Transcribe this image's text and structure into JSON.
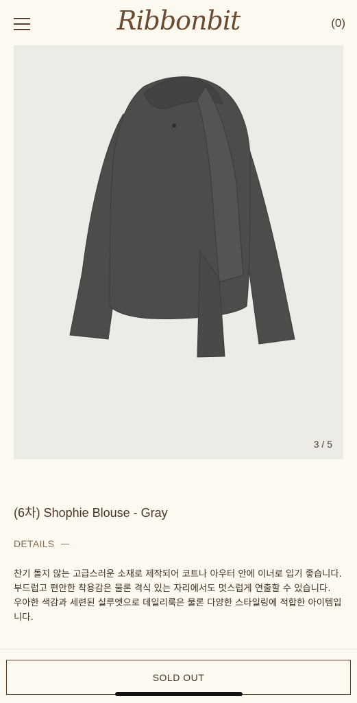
{
  "header": {
    "brand": "Ribbonbit",
    "cart_count": "(0)"
  },
  "gallery": {
    "counter": "3 / 5",
    "background": "#ecebe6",
    "garment_color": "#4d4c4a"
  },
  "product": {
    "title": "(6차) Shophie Blouse - Gray",
    "details_label": "DETAILS",
    "description": [
      "찬기 돌지 않는 고급스러운 소재로 제작되어 코트나 아우터 안에 이너로 입기 좋습니다.",
      "부드럽고 편안한 착용감은 물론 격식 있는 자리에서도 멋스럽게 연출할 수 있습니다.",
      "우아한 색감과 세련된 실루엣으로 데일리룩은 물론 다양한 스타일링에 적합한 아이템입니다."
    ]
  },
  "actions": {
    "sold_out_label": "SOLD OUT"
  }
}
